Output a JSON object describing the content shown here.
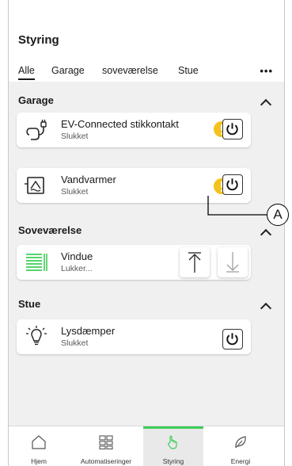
{
  "header": {
    "title": "Styring"
  },
  "tabs": [
    {
      "label": "Alle"
    },
    {
      "label": "Garage"
    },
    {
      "label": "soveværelse"
    },
    {
      "label": "Stue"
    }
  ],
  "more_label": "•••",
  "sections": {
    "garage": {
      "title": "Garage",
      "devices": [
        {
          "name": "EV-Connected stikkontakt",
          "status": "Slukket",
          "icon": "ev-charger-icon",
          "warning": true
        },
        {
          "name": "Vandvarmer",
          "status": "Slukket",
          "icon": "water-heater-icon",
          "warning": true
        }
      ]
    },
    "bedroom": {
      "title": "Soveværelse",
      "devices": [
        {
          "name": "Vindue",
          "status": "Lukker...",
          "icon": "window-shade-icon"
        }
      ]
    },
    "living": {
      "title": "Stue",
      "devices": [
        {
          "name": "Lysdæmper",
          "status": "Slukket",
          "icon": "dimmer-bulb-icon"
        }
      ]
    }
  },
  "callout": {
    "label": "A"
  },
  "nav": [
    {
      "label": "Hjem",
      "icon": "home-icon"
    },
    {
      "label": "Automatiseringer",
      "icon": "grid-icon"
    },
    {
      "label": "Styring",
      "icon": "hand-touch-icon",
      "active": true
    },
    {
      "label": "Energi",
      "icon": "leaf-icon"
    }
  ],
  "colors": {
    "accent": "#3dcd58",
    "warning": "#f4c21c"
  }
}
